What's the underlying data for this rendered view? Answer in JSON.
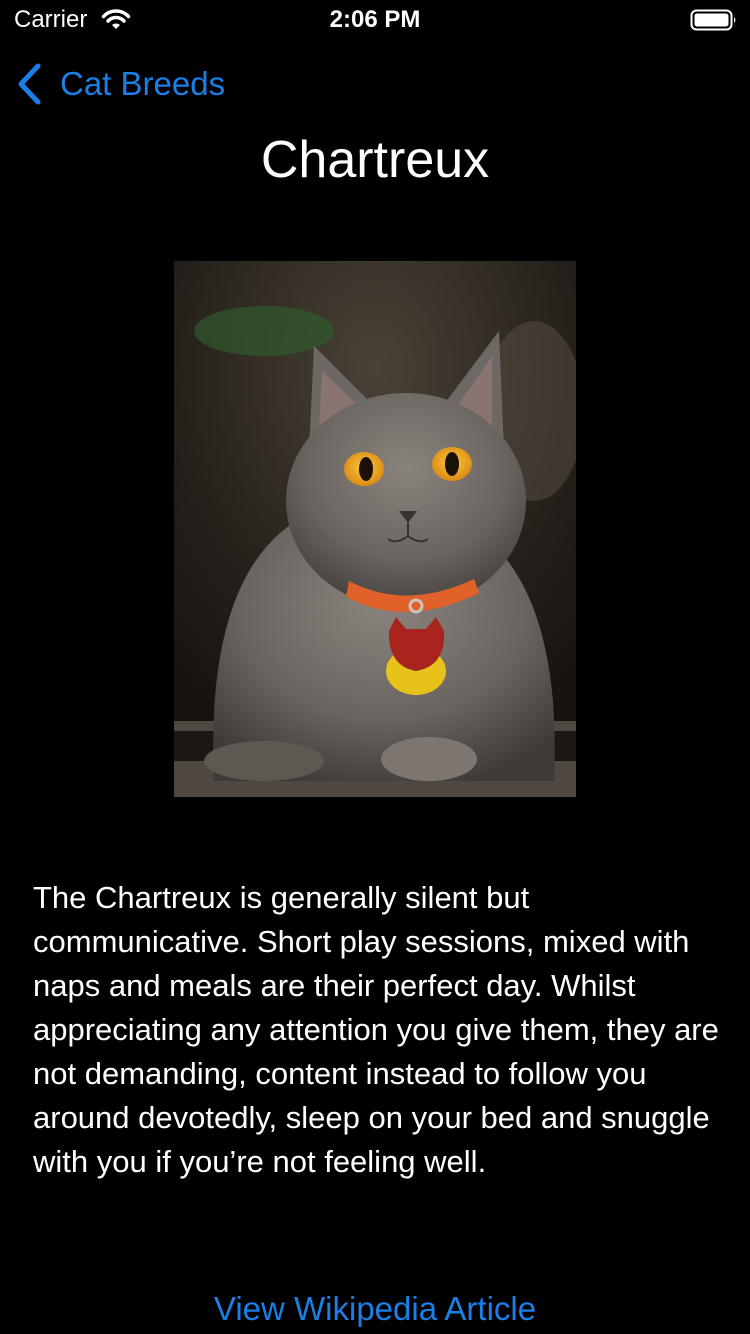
{
  "status_bar": {
    "carrier": "Carrier",
    "time": "2:06 PM"
  },
  "nav": {
    "back_label": "Cat Breeds",
    "title": "Chartreux"
  },
  "breed": {
    "description": "The Chartreux is generally silent but communicative. Short play sessions, mixed with naps and meals are their perfect day. Whilst appreciating any attention you give them, they are not demanding, content instead to follow you around devotedly, sleep on your bed and snuggle with you if you’re not feeling well.",
    "link_label": "View Wikipedia Article"
  },
  "colors": {
    "accent": "#1a7fe6",
    "background": "#000000",
    "text": "#ffffff"
  },
  "icons": [
    "wifi-icon",
    "battery-icon",
    "chevron-left-icon"
  ]
}
